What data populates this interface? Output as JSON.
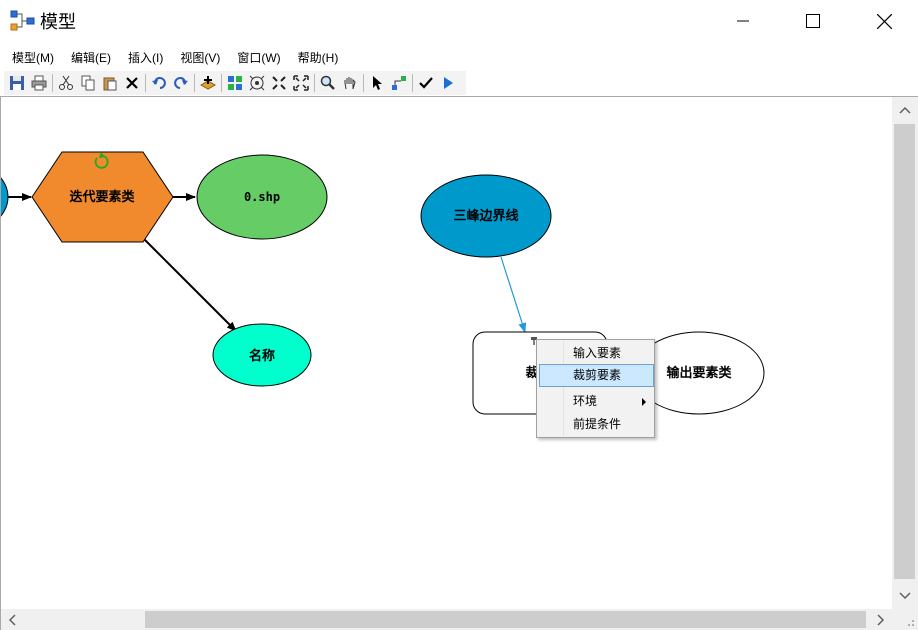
{
  "window": {
    "title": "模型"
  },
  "menu": [
    "模型(M)",
    "编辑(E)",
    "插入(I)",
    "视图(V)",
    "窗口(W)",
    "帮助(H)"
  ],
  "toolbar": {
    "buttons": [
      "save-icon",
      "print-icon",
      "cut-icon",
      "copy-icon",
      "paste-icon",
      "delete-icon",
      "undo-icon",
      "redo-icon",
      "add-data-icon",
      "auto-layout-icon",
      "full-extent-icon",
      "zoom-in-fixed-icon",
      "zoom-out-fixed-icon",
      "zoom-icon",
      "pan-icon",
      "select-icon",
      "connect-icon",
      "validate-icon",
      "run-icon"
    ]
  },
  "diagram": {
    "nodes": {
      "iterator": "迭代要素类",
      "output_shp": "0.shp",
      "name": "名称",
      "boundary": "三峰边界线",
      "clip_partial": "裁",
      "output_fc": "输出要素类"
    },
    "colors": {
      "iterator": "#f08a2c",
      "output_shp": "#66cc66",
      "name": "#00ffcc",
      "boundary": "#0099cc",
      "connector": "#2299dd"
    }
  },
  "context_menu": {
    "items": [
      "输入要素",
      "裁剪要素",
      "环境",
      "前提条件"
    ],
    "highlighted": "裁剪要素"
  }
}
